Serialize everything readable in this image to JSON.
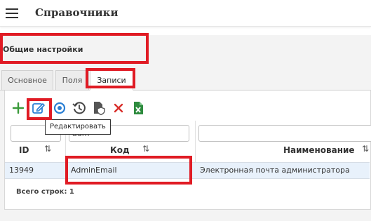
{
  "header": {
    "title": "Справочники",
    "menu_icon": "hamburger-icon"
  },
  "section": {
    "title": "Общие настройки"
  },
  "tabs": [
    {
      "label": "Основное",
      "active": false
    },
    {
      "label": "Поля",
      "active": false
    },
    {
      "label": "Записи",
      "active": true
    }
  ],
  "toolbar": {
    "buttons": [
      {
        "icon": "plus-icon",
        "color": "#3a9a3a"
      },
      {
        "icon": "edit-icon",
        "color": "#2a7fd4"
      },
      {
        "icon": "eye-icon",
        "color": "#2a7fd4"
      },
      {
        "icon": "history-icon",
        "color": "#444444"
      },
      {
        "icon": "file-shield-icon",
        "color": "#555555"
      },
      {
        "icon": "delete-icon",
        "color": "#d9302c"
      },
      {
        "icon": "excel-icon",
        "color": "#2e8b3e"
      }
    ],
    "tooltip": "Редактировать"
  },
  "table": {
    "filters": {
      "id": "",
      "code": "adm",
      "name": ""
    },
    "columns": [
      {
        "label": "ID",
        "sort_icon": "⇅"
      },
      {
        "label": "Код",
        "sort_icon": "⇅"
      },
      {
        "label": "Наименование",
        "sort_icon": "⇅"
      }
    ],
    "rows": [
      {
        "id": "13949",
        "code": "AdminEmail",
        "name": "Электронная почта администратора"
      }
    ],
    "footer": "Всего строк: 1"
  },
  "colors": {
    "highlight": "#e01b24",
    "row_selected": "#e8f1fb",
    "accent": "#2a7fd4"
  }
}
